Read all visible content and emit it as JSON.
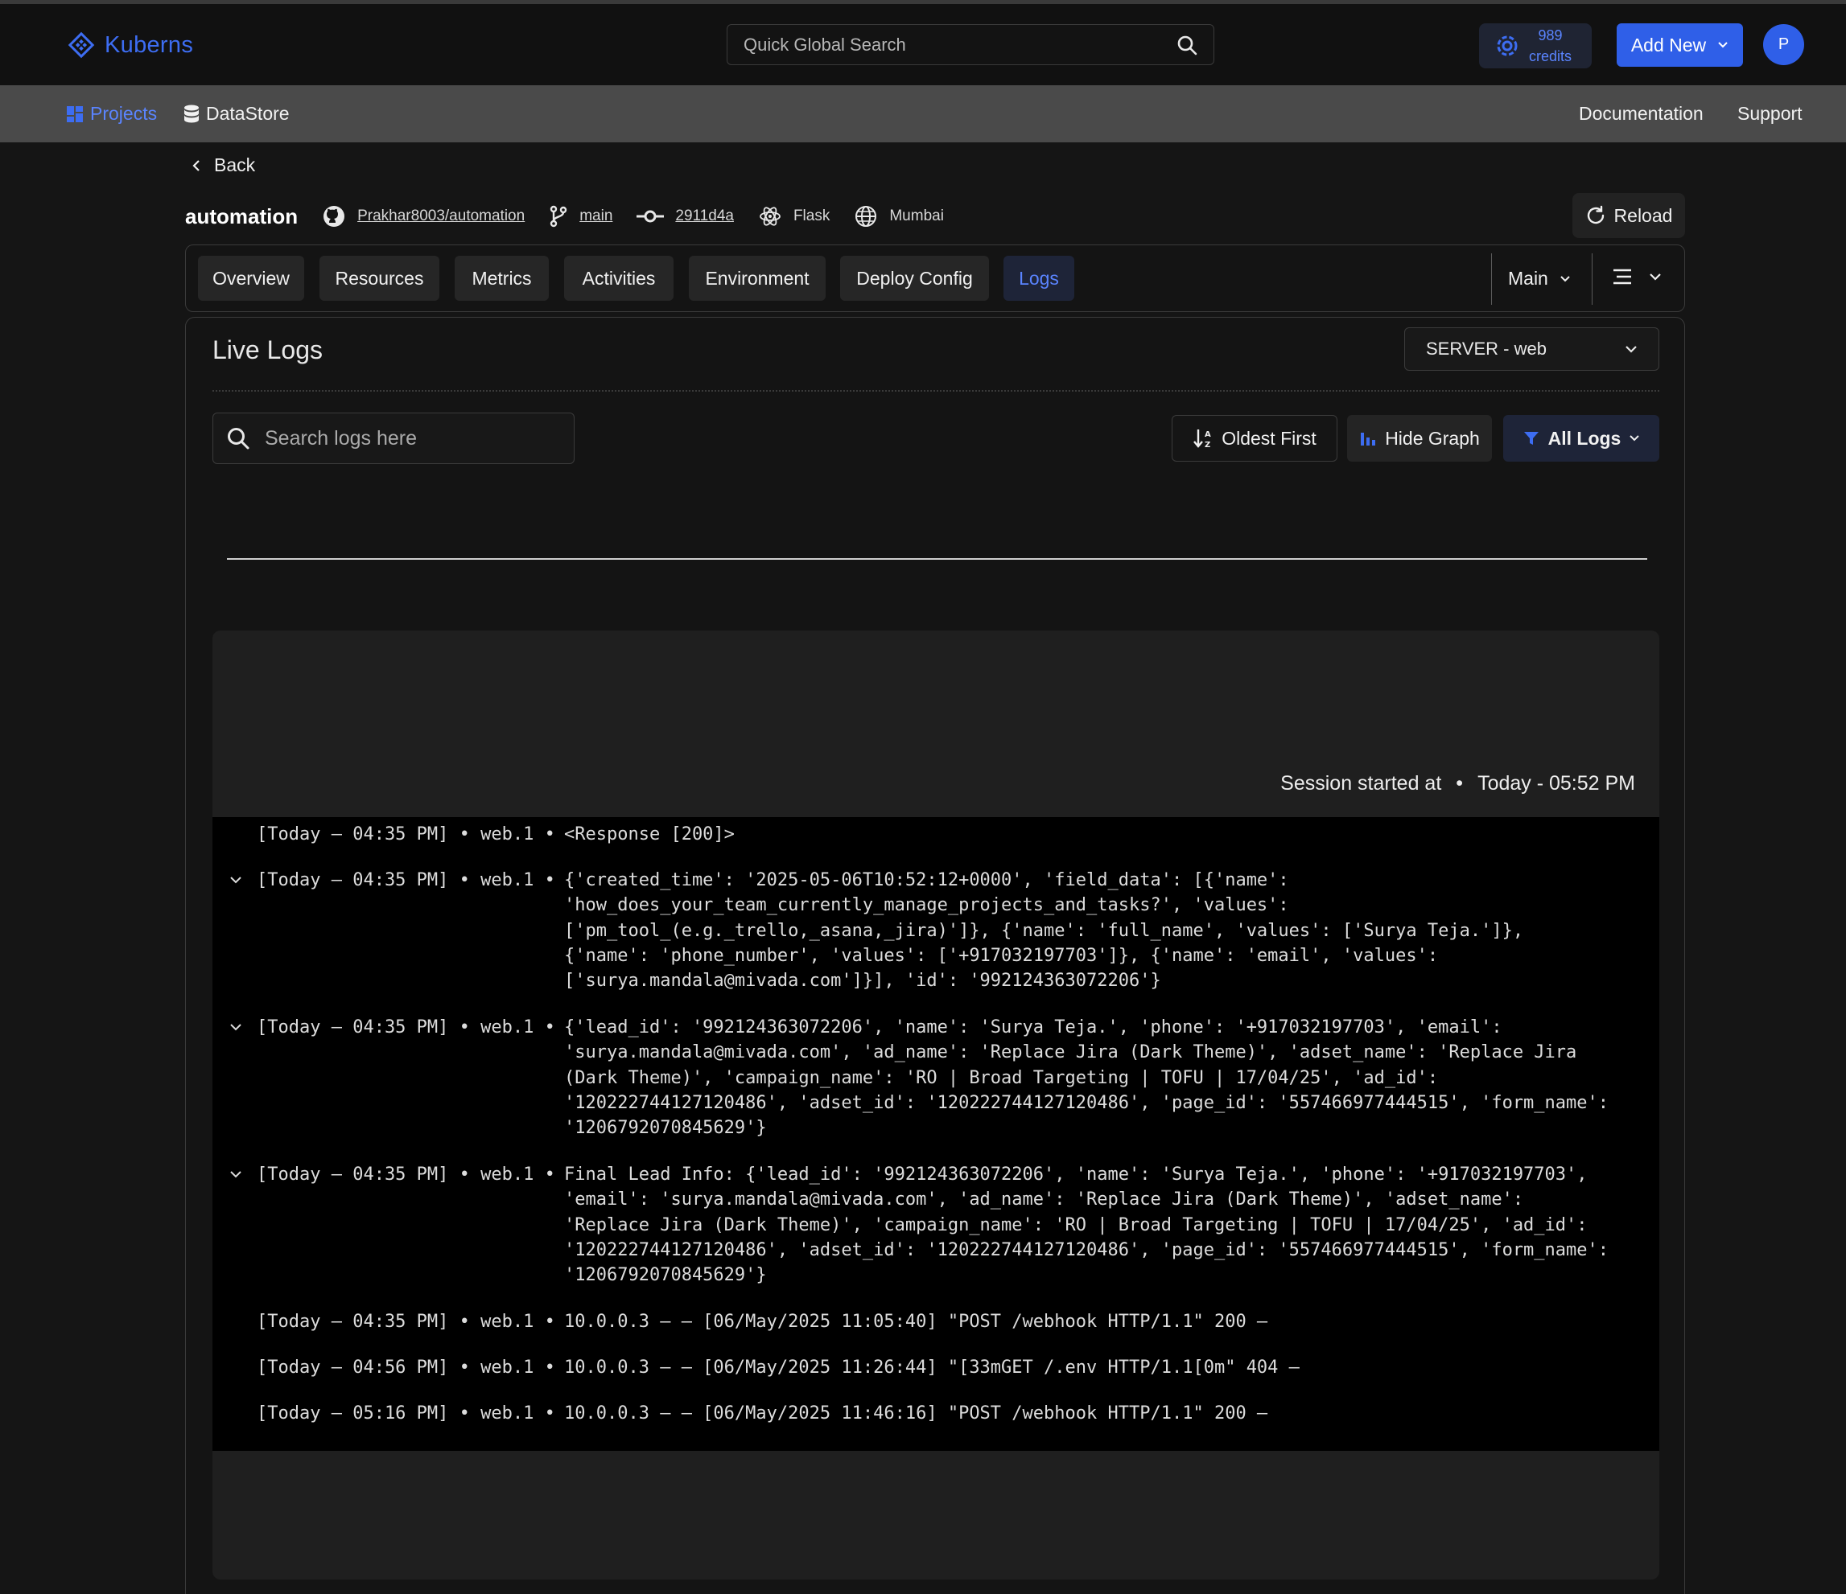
{
  "header": {
    "brand": "Kuberns",
    "search_placeholder": "Quick Global Search",
    "credits_value": "989",
    "credits_label": "credits",
    "add_new_label": "Add New",
    "avatar_initial": "P",
    "accent_color": "#2f5fe8"
  },
  "subnav": {
    "projects_label": "Projects",
    "datastore_label": "DataStore",
    "documentation_label": "Documentation",
    "support_label": "Support"
  },
  "back_label": "Back",
  "project": {
    "name": "automation",
    "repo": "Prakhar8003/automation",
    "branch": "main",
    "commit": "2911d4a",
    "framework": "Flask",
    "region": "Mumbai",
    "reload_label": "Reload"
  },
  "tabs": [
    {
      "label": "Overview"
    },
    {
      "label": "Resources"
    },
    {
      "label": "Metrics"
    },
    {
      "label": "Activities"
    },
    {
      "label": "Environment"
    },
    {
      "label": "Deploy Config"
    },
    {
      "label": "Logs",
      "active": true
    }
  ],
  "env_selector": "Main",
  "live_logs": {
    "title": "Live Logs",
    "server_select": "SERVER - web",
    "search_placeholder": "Search logs here",
    "sort_label": "Oldest First",
    "graph_toggle_label": "Hide Graph",
    "filter_label": "All Logs",
    "session_label": "Session started at",
    "session_time": "Today - 05:52 PM",
    "entries": [
      {
        "expandable": false,
        "prefix": "[Today – 04:35 PM] • web.1 •",
        "message": "<Response [200]>"
      },
      {
        "expandable": true,
        "prefix": "[Today – 04:35 PM] • web.1 •",
        "message": "{'created_time': '2025-05-06T10:52:12+0000', 'field_data': [{'name':\n'how_does_your_team_currently_manage_projects_and_tasks?', 'values':\n['pm_tool_(e.g._trello,_asana,_jira)']}, {'name': 'full_name', 'values': ['Surya Teja.']},\n{'name': 'phone_number', 'values': ['+917032197703']}, {'name': 'email', 'values':\n['surya.mandala@mivada.com']}], 'id': '992124363072206'}"
      },
      {
        "expandable": true,
        "prefix": "[Today – 04:35 PM] • web.1 •",
        "message": "{'lead_id': '992124363072206', 'name': 'Surya Teja.', 'phone': '+917032197703', 'email':\n'surya.mandala@mivada.com', 'ad_name': 'Replace Jira (Dark Theme)', 'adset_name': 'Replace Jira\n(Dark Theme)', 'campaign_name': 'RO | Broad Targeting | TOFU | 17/04/25', 'ad_id':\n'120222744127120486', 'adset_id': '120222744127120486', 'page_id': '557466977444515', 'form_name':\n'1206792070845629'}"
      },
      {
        "expandable": true,
        "prefix": "[Today – 04:35 PM] • web.1 •",
        "message": "Final Lead Info: {'lead_id': '992124363072206', 'name': 'Surya Teja.', 'phone': '+917032197703',\n'email': 'surya.mandala@mivada.com', 'ad_name': 'Replace Jira (Dark Theme)', 'adset_name':\n'Replace Jira (Dark Theme)', 'campaign_name': 'RO | Broad Targeting | TOFU | 17/04/25', 'ad_id':\n'120222744127120486', 'adset_id': '120222744127120486', 'page_id': '557466977444515', 'form_name':\n'1206792070845629'}"
      },
      {
        "expandable": false,
        "prefix": "[Today – 04:35 PM] • web.1 •",
        "message": "10.0.0.3 – – [06/May/2025 11:05:40] \"POST /webhook HTTP/1.1\" 200 –"
      },
      {
        "expandable": false,
        "prefix": "[Today – 04:56 PM] • web.1 •",
        "message": "10.0.0.3 – – [06/May/2025 11:26:44] \"[33mGET /.env HTTP/1.1[0m\" 404 –"
      },
      {
        "expandable": false,
        "prefix": "[Today – 05:16 PM] • web.1 •",
        "message": "10.0.0.3 – – [06/May/2025 11:46:16] \"POST /webhook HTTP/1.1\" 200 –"
      }
    ]
  }
}
